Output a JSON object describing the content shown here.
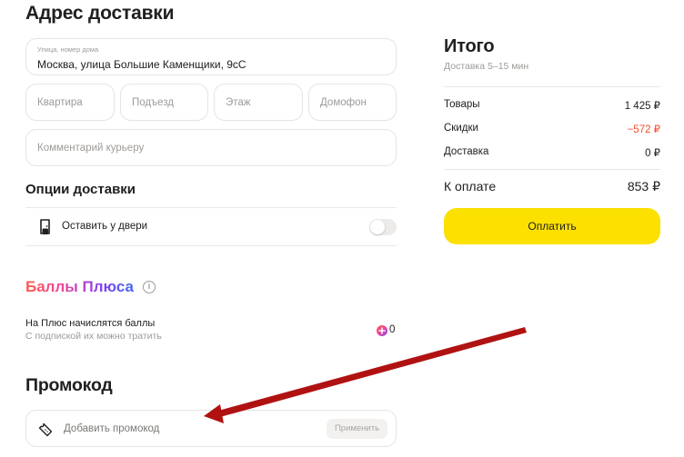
{
  "address": {
    "heading": "Адрес доставки",
    "street_label": "Улица, номер дома",
    "street_value": "Москва, улица Большие Каменщики, 9сС",
    "apartment_placeholder": "Квартира",
    "entrance_placeholder": "Подъезд",
    "floor_placeholder": "Этаж",
    "intercom_placeholder": "Домофон",
    "comment_placeholder": "Комментарий курьеру"
  },
  "delivery_options": {
    "heading": "Опции доставки",
    "leave_at_door_label": "Оставить у двери",
    "leave_at_door_enabled": false
  },
  "plus": {
    "heading": "Баллы Плюса",
    "line1": "На Плюс начислятся баллы",
    "line2": "С подпиской их можно тратить",
    "points": "0"
  },
  "promo": {
    "heading": "Промокод",
    "placeholder": "Добавить промокод",
    "apply_label": "Применить"
  },
  "summary": {
    "heading": "Итого",
    "delivery_time": "Доставка 5–15 мин",
    "rows": [
      {
        "label": "Товары",
        "value": "1 425 ₽"
      },
      {
        "label": "Скидки",
        "value": "−572 ₽"
      },
      {
        "label": "Доставка",
        "value": "0 ₽"
      }
    ],
    "total_label": "К оплате",
    "total_value": "853 ₽",
    "pay_label": "Оплатить"
  },
  "colors": {
    "pay_button": "#fce000",
    "discount": "#f44d2b",
    "annotation_arrow": "#b01212"
  }
}
